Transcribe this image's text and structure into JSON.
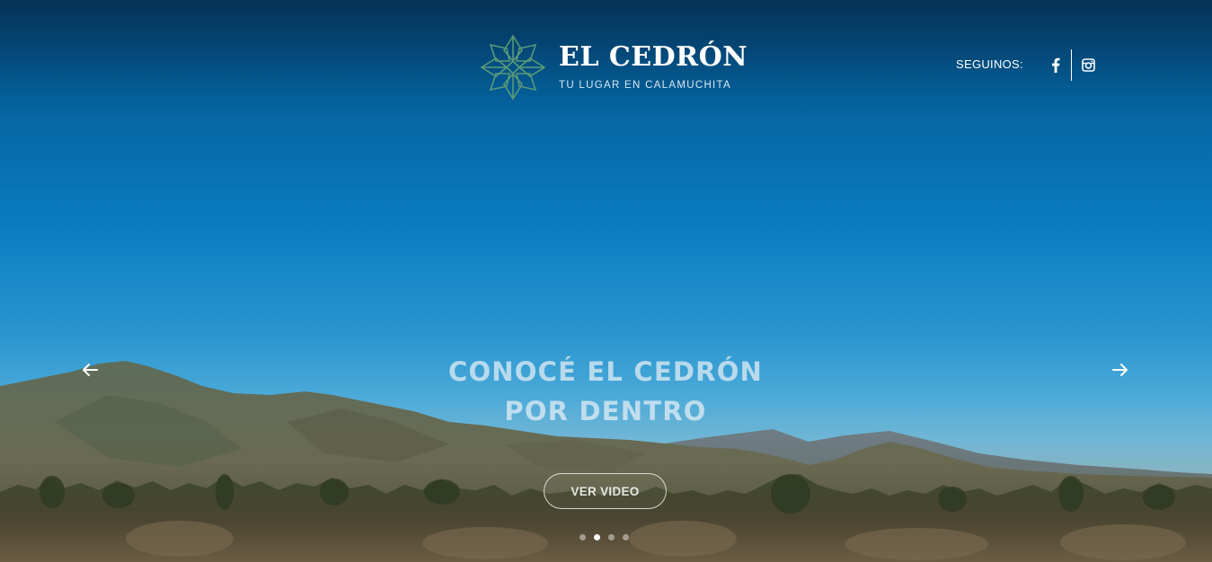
{
  "brand": {
    "name": "EL CEDRÓN",
    "tagline": "TU LUGAR EN CALAMUCHITA",
    "logo_icon": "leaf-star-logo-icon",
    "logo_color": "#5a9a78"
  },
  "header": {
    "follow_label": "SEGUINOS:",
    "social": [
      {
        "name": "facebook-icon"
      },
      {
        "name": "instagram-icon"
      }
    ]
  },
  "slider": {
    "headline_line1": "CONOCÉ EL CEDRÓN",
    "headline_line2": "POR DENTRO",
    "button_label": "VER VIDEO",
    "prev_icon": "arrow-left-icon",
    "next_icon": "arrow-right-icon",
    "slide_count": 4,
    "active_slide": 2
  },
  "colors": {
    "sky_top": "#0a4470",
    "sky_mid": "#0a7cc0",
    "text": "#ffffff"
  }
}
